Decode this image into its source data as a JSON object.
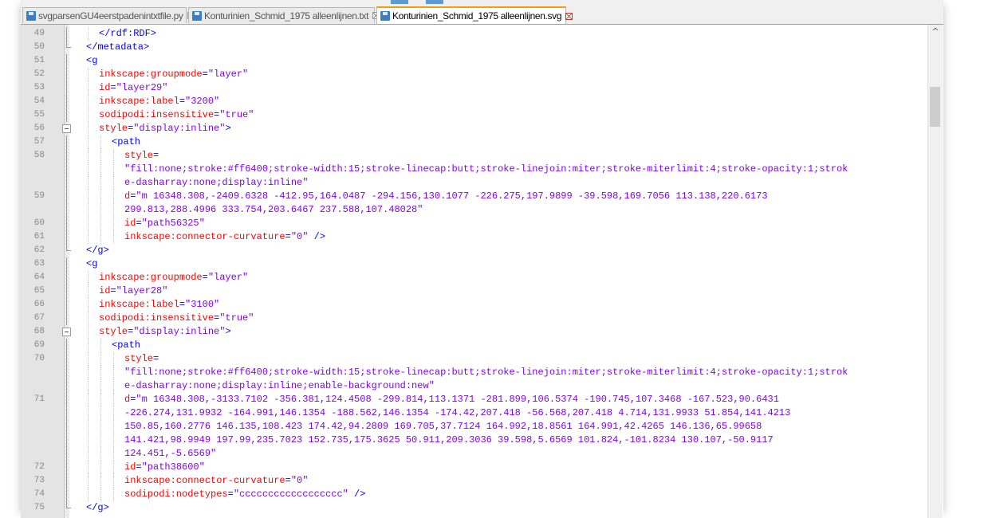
{
  "tabs": [
    {
      "name": "svgparsenGU4eerstpadenintxtfile.py",
      "active": false
    },
    {
      "name": "Konturinien_Schmid_1975 alleenlijnen.txt",
      "active": false
    },
    {
      "name": "Konturinien_Schmid_1975 alleenlijnen.svg",
      "active": true
    }
  ],
  "colors": {
    "tag": "#0000ff",
    "attribute": "#ff0000",
    "value": "#8000ff",
    "active_tab_accent": "#f39c12"
  },
  "scrollbar": {
    "up_arrow": "^",
    "position_fraction": 0.11
  },
  "lines": [
    {
      "n": "49",
      "fold": "line",
      "i": 1,
      "t": [
        [
          "tag",
          "</rdf:RDF>"
        ]
      ]
    },
    {
      "n": "50",
      "fold": "end",
      "i": 0,
      "t": [
        [
          "tag",
          "</metadata>"
        ]
      ]
    },
    {
      "n": "51",
      "fold": "line",
      "i": 0,
      "t": [
        [
          "tag",
          "<g"
        ]
      ]
    },
    {
      "n": "52",
      "fold": "line",
      "i": 1,
      "t": [
        [
          "attr",
          "inkscape:groupmode"
        ],
        [
          "tag",
          "="
        ],
        [
          "val",
          "\"layer\""
        ]
      ]
    },
    {
      "n": "53",
      "fold": "line",
      "i": 1,
      "t": [
        [
          "attr",
          "id"
        ],
        [
          "tag",
          "="
        ],
        [
          "val",
          "\"layer29\""
        ]
      ]
    },
    {
      "n": "54",
      "fold": "line",
      "i": 1,
      "t": [
        [
          "attr",
          "inkscape:label"
        ],
        [
          "tag",
          "="
        ],
        [
          "val",
          "\"3200\""
        ]
      ]
    },
    {
      "n": "55",
      "fold": "line",
      "i": 1,
      "t": [
        [
          "attr",
          "sodipodi:insensitive"
        ],
        [
          "tag",
          "="
        ],
        [
          "val",
          "\"true\""
        ]
      ]
    },
    {
      "n": "56",
      "fold": "box",
      "i": 1,
      "t": [
        [
          "attr",
          "style"
        ],
        [
          "tag",
          "="
        ],
        [
          "val",
          "\"display:inline\""
        ],
        [
          "tag",
          ">"
        ]
      ]
    },
    {
      "n": "57",
      "fold": "line",
      "i": 2,
      "t": [
        [
          "tag",
          "<path"
        ]
      ]
    },
    {
      "n": "58",
      "fold": "line",
      "i": 3,
      "t": [
        [
          "attr",
          "style"
        ],
        [
          "tag",
          "="
        ]
      ]
    },
    {
      "n": "",
      "fold": "line",
      "i": 3,
      "t": [
        [
          "val",
          "\"fill:none;stroke:#ff6400;stroke-width:15;stroke-linecap:butt;stroke-linejoin:miter;stroke-miterlimit:4;stroke-opacity:1;strok"
        ]
      ]
    },
    {
      "n": "",
      "fold": "line",
      "i": 3,
      "t": [
        [
          "val",
          "e-dasharray:none;display:inline\""
        ]
      ]
    },
    {
      "n": "59",
      "fold": "line",
      "i": 3,
      "t": [
        [
          "attr",
          "d"
        ],
        [
          "tag",
          "="
        ],
        [
          "val",
          "\"m 16348.308,-2409.6328 -412.95,164.0487 -294.156,130.1077 -226.275,197.9899 -39.598,169.7056 113.138,220.6173"
        ]
      ]
    },
    {
      "n": "",
      "fold": "line",
      "i": 3,
      "t": [
        [
          "val",
          "299.813,288.4996 333.754,203.6467 237.588,107.48028\""
        ]
      ]
    },
    {
      "n": "60",
      "fold": "line",
      "i": 3,
      "t": [
        [
          "attr",
          "id"
        ],
        [
          "tag",
          "="
        ],
        [
          "val",
          "\"path56325\""
        ]
      ]
    },
    {
      "n": "61",
      "fold": "line",
      "i": 3,
      "t": [
        [
          "attr",
          "inkscape:connector-curvature"
        ],
        [
          "tag",
          "="
        ],
        [
          "val",
          "\"0\""
        ],
        [
          "tag",
          " />"
        ]
      ]
    },
    {
      "n": "62",
      "fold": "end",
      "i": 0,
      "t": [
        [
          "tag",
          "</g>"
        ]
      ]
    },
    {
      "n": "63",
      "fold": "line",
      "i": 0,
      "t": [
        [
          "tag",
          "<g"
        ]
      ]
    },
    {
      "n": "64",
      "fold": "line",
      "i": 1,
      "t": [
        [
          "attr",
          "inkscape:groupmode"
        ],
        [
          "tag",
          "="
        ],
        [
          "val",
          "\"layer\""
        ]
      ]
    },
    {
      "n": "65",
      "fold": "line",
      "i": 1,
      "t": [
        [
          "attr",
          "id"
        ],
        [
          "tag",
          "="
        ],
        [
          "val",
          "\"layer28\""
        ]
      ]
    },
    {
      "n": "66",
      "fold": "line",
      "i": 1,
      "t": [
        [
          "attr",
          "inkscape:label"
        ],
        [
          "tag",
          "="
        ],
        [
          "val",
          "\"3100\""
        ]
      ]
    },
    {
      "n": "67",
      "fold": "line",
      "i": 1,
      "t": [
        [
          "attr",
          "sodipodi:insensitive"
        ],
        [
          "tag",
          "="
        ],
        [
          "val",
          "\"true\""
        ]
      ]
    },
    {
      "n": "68",
      "fold": "box",
      "i": 1,
      "t": [
        [
          "attr",
          "style"
        ],
        [
          "tag",
          "="
        ],
        [
          "val",
          "\"display:inline\""
        ],
        [
          "tag",
          ">"
        ]
      ]
    },
    {
      "n": "69",
      "fold": "line",
      "i": 2,
      "t": [
        [
          "tag",
          "<path"
        ]
      ]
    },
    {
      "n": "70",
      "fold": "line",
      "i": 3,
      "t": [
        [
          "attr",
          "style"
        ],
        [
          "tag",
          "="
        ]
      ]
    },
    {
      "n": "",
      "fold": "line",
      "i": 3,
      "t": [
        [
          "val",
          "\"fill:none;stroke:#ff6400;stroke-width:15;stroke-linecap:butt;stroke-linejoin:miter;stroke-miterlimit:4;stroke-opacity:1;strok"
        ]
      ]
    },
    {
      "n": "",
      "fold": "line",
      "i": 3,
      "t": [
        [
          "val",
          "e-dasharray:none;display:inline;enable-background:new\""
        ]
      ]
    },
    {
      "n": "71",
      "fold": "line",
      "i": 3,
      "t": [
        [
          "attr",
          "d"
        ],
        [
          "tag",
          "="
        ],
        [
          "val",
          "\"m 16348.308,-3133.7102 -356.381,124.4508 -299.814,113.1371 -281.899,106.5374 -190.745,107.3468 -167.523,90.6431"
        ]
      ]
    },
    {
      "n": "",
      "fold": "line",
      "i": 3,
      "t": [
        [
          "val",
          "-226.274,131.9932 -164.991,146.1354 -188.562,146.1354 -174.42,207.418 -56.568,207.418 4.714,131.9933 51.854,141.4213"
        ]
      ]
    },
    {
      "n": "",
      "fold": "line",
      "i": 3,
      "t": [
        [
          "val",
          "150.85,160.2776 146.135,108.423 174.42,94.2809 169.705,37.7124 164.992,18.8561 164.991,42.4265 146.136,65.99658"
        ]
      ]
    },
    {
      "n": "",
      "fold": "line",
      "i": 3,
      "t": [
        [
          "val",
          "141.421,98.9949 197.99,235.7023 152.735,175.3625 50.911,209.3036 39.598,5.6569 101.824,-101.8234 130.107,-50.9117"
        ]
      ]
    },
    {
      "n": "",
      "fold": "line",
      "i": 3,
      "t": [
        [
          "val",
          "124.451,-5.6569\""
        ]
      ]
    },
    {
      "n": "72",
      "fold": "line",
      "i": 3,
      "t": [
        [
          "attr",
          "id"
        ],
        [
          "tag",
          "="
        ],
        [
          "val",
          "\"path38600\""
        ]
      ]
    },
    {
      "n": "73",
      "fold": "line",
      "i": 3,
      "t": [
        [
          "attr",
          "inkscape:connector-curvature"
        ],
        [
          "tag",
          "="
        ],
        [
          "val",
          "\"0\""
        ]
      ]
    },
    {
      "n": "74",
      "fold": "line",
      "i": 3,
      "t": [
        [
          "attr",
          "sodipodi:nodetypes"
        ],
        [
          "tag",
          "="
        ],
        [
          "val",
          "\"cccccccccccccccccc\""
        ],
        [
          "tag",
          " />"
        ]
      ]
    },
    {
      "n": "75",
      "fold": "end",
      "i": 0,
      "t": [
        [
          "tag",
          "</g>"
        ]
      ]
    }
  ]
}
